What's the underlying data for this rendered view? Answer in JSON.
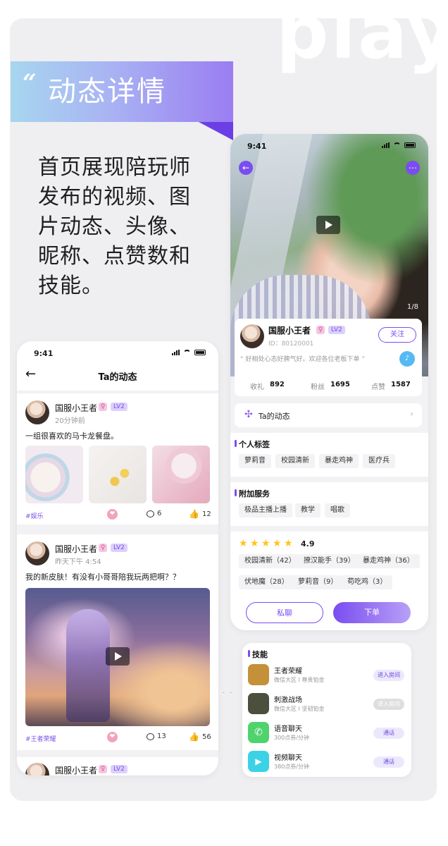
{
  "watermark": "play",
  "banner": {
    "quote": "“",
    "title": "动态详情"
  },
  "description": "首页展现陪玩师发布的视频、图片动态、头像、昵称、点赞数和技能。",
  "left_phone": {
    "time": "9:41",
    "title": "Ta的动态",
    "posts": [
      {
        "name": "国服小王者",
        "gender": "♀",
        "level": "LV2",
        "time": "20分钟前",
        "text": "一组很喜欢的马卡龙餐盘。",
        "tag": "#娱乐",
        "comments": "6",
        "likes": "12"
      },
      {
        "name": "国服小王者",
        "gender": "♀",
        "level": "LV2",
        "time": "昨天下午 4:54",
        "text": "我的新皮肤！有没有小哥哥陪我玩两把啊？？",
        "tag": "#王者荣耀",
        "comments": "13",
        "likes": "56"
      },
      {
        "name": "国服小王者",
        "gender": "♀",
        "level": "LV2"
      }
    ]
  },
  "right_phone": {
    "time": "9:41",
    "pager": "1/8",
    "profile": {
      "name": "国服小王者",
      "gender": "♀",
      "level": "LV2",
      "id": "ID：80120001",
      "follow": "关注",
      "quote": "“ 好相处心态好脾气好。欢迎各位老板下单 ”"
    },
    "stats": [
      {
        "k": "收礼",
        "v": "892"
      },
      {
        "k": "粉丝",
        "v": "1695"
      },
      {
        "k": "点赞",
        "v": "1587"
      }
    ],
    "dynamics_label": "Ta的动态",
    "personal_tags_title": "个人标签",
    "personal_tags": [
      "萝莉音",
      "校园清新",
      "暴走鸡神",
      "医疗兵"
    ],
    "extra_title": "附加服务",
    "extra_tags": [
      "极品主播上播",
      "教学",
      "唱歌"
    ],
    "rating": "4.9",
    "review_tags": [
      "校园清新（42）",
      "撩汉能手（39）",
      "暴走鸡神（36）",
      "伏地魔（28）",
      "萝莉音（9）",
      "苟吃鸡（3）"
    ],
    "chat_btn": "私聊",
    "order_btn": "下单"
  },
  "skills": {
    "title": "技能",
    "items": [
      {
        "name": "王者荣耀",
        "sub": "微信大区 I 尊贵铂金",
        "btn": "进入房间",
        "color": "#c4903a"
      },
      {
        "name": "刺激战场",
        "sub": "微信大区 I 坚韧铂金",
        "btn": "进入房间",
        "color": "#4b4f3e"
      },
      {
        "name": "语音聊天",
        "sub": "300点券/分钟",
        "btn": "通话",
        "color": "#4fd36c"
      },
      {
        "name": "视频聊天",
        "sub": "380点券/分钟",
        "btn": "通话",
        "color": "#3cd2e6"
      }
    ]
  }
}
